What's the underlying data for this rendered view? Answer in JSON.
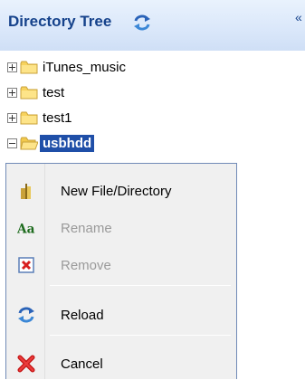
{
  "header": {
    "title": "Directory Tree",
    "reload_icon": "reload-arrows-icon",
    "collapse_glyph": "«",
    "background": "#dbe8fa",
    "title_color": "#15428b"
  },
  "tree": {
    "nodes": [
      {
        "label": "iTunes_music",
        "expanded": false,
        "icon": "folder-icon"
      },
      {
        "label": "test",
        "expanded": false,
        "icon": "folder-icon"
      },
      {
        "label": "test1",
        "expanded": false,
        "icon": "folder-icon"
      },
      {
        "label": "usbhdd",
        "expanded": true,
        "selected": true,
        "icon": "folder-open-icon"
      }
    ],
    "selected_color": "#1f4fa8"
  },
  "context_menu": {
    "items": [
      {
        "label": "New File/Directory",
        "icon": "new-file-icon",
        "enabled": true
      },
      {
        "label": "Rename",
        "icon": "rename-aa-icon",
        "enabled": false
      },
      {
        "label": "Remove",
        "icon": "remove-x-icon",
        "enabled": false
      },
      {
        "label": "Reload",
        "icon": "reload-arrows-icon",
        "enabled": true
      },
      {
        "label": "Cancel",
        "icon": "cancel-x-icon",
        "enabled": true
      }
    ],
    "border_color": "#718bb7",
    "background": "#f0f0f0",
    "disabled_text_color": "#9a9a9a"
  }
}
